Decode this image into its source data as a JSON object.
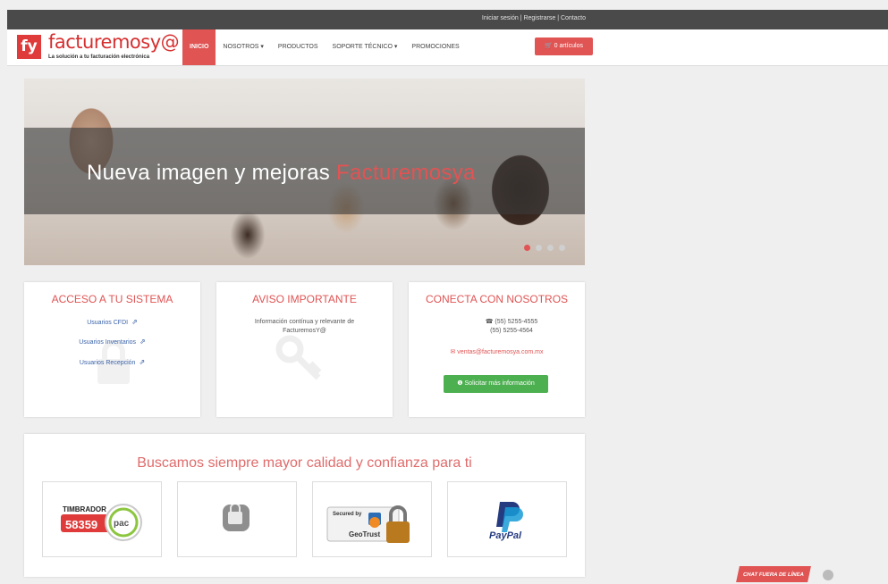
{
  "top_links": {
    "login": "Iniciar sesión",
    "sep1": " | ",
    "register": "Registrarse",
    "sep2": " | ",
    "contact": "Contacto"
  },
  "brand": {
    "logo_mark": "fy",
    "name": "facturemosy@",
    "tagline": "La solución a tu facturación electrónica"
  },
  "nav": {
    "items": [
      "INICIO",
      "NOSOTROS ▾",
      "PRODUCTOS",
      "SOPORTE TÉCNICO ▾",
      "PROMOCIONES"
    ],
    "cart": "🛒 0 artículos"
  },
  "hero": {
    "title_main": "Nueva imagen y mejoras ",
    "title_brand": "Facturemosya",
    "dots": 4,
    "active_dot": 0
  },
  "panels": {
    "access": {
      "title": "ACCESO A TU SISTEMA",
      "links": [
        "Usuarios CFDI",
        "Usuarios Inventarios",
        "Usuarios Recepción"
      ]
    },
    "notice": {
      "title": "AVISO IMPORTANTE",
      "text": "Información contínua y relevante de FacturemosY@"
    },
    "connect": {
      "title": "CONECTA CON NOSOTROS",
      "phone1": "(55) 5255-4555",
      "phone2": "(55) 5255-4564",
      "email": "ventas@facturemosya.com.mx",
      "button": "Solicitar más información"
    }
  },
  "quality": {
    "heading": "Buscamos siempre mayor calidad y confianza para ti",
    "badges": {
      "timbrador_label": "TIMBRADOR",
      "timbrador_num": "58359",
      "pac": "pac",
      "secured_by": "Secured by",
      "geotrust": "GeoTrust",
      "paypal": "PayPal"
    }
  },
  "chat": {
    "label": "CHAT FUERA DE LÍNEA"
  },
  "colors": {
    "accent": "#e05454",
    "green": "#4caf50",
    "link": "#3a62a8"
  }
}
